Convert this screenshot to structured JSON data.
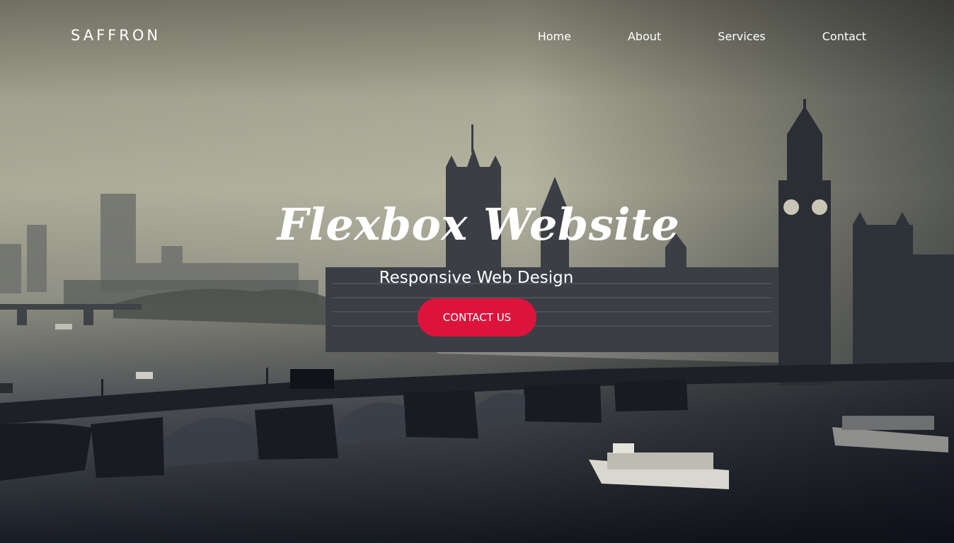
{
  "brand": {
    "name": "SAFFRON"
  },
  "nav": {
    "items": [
      {
        "label": "Home"
      },
      {
        "label": "About"
      },
      {
        "label": "Services"
      },
      {
        "label": "Contact"
      }
    ]
  },
  "hero": {
    "title": "Flexbox Website",
    "subtitle": "Responsive Web Design",
    "cta_label": "CONTACT US",
    "background_subject": "london-skyline-thames-photo"
  },
  "colors": {
    "accent": "#dc143c",
    "text": "#ffffff",
    "sky_top": "#b8b7a3",
    "water_dark": "#1c2028"
  }
}
